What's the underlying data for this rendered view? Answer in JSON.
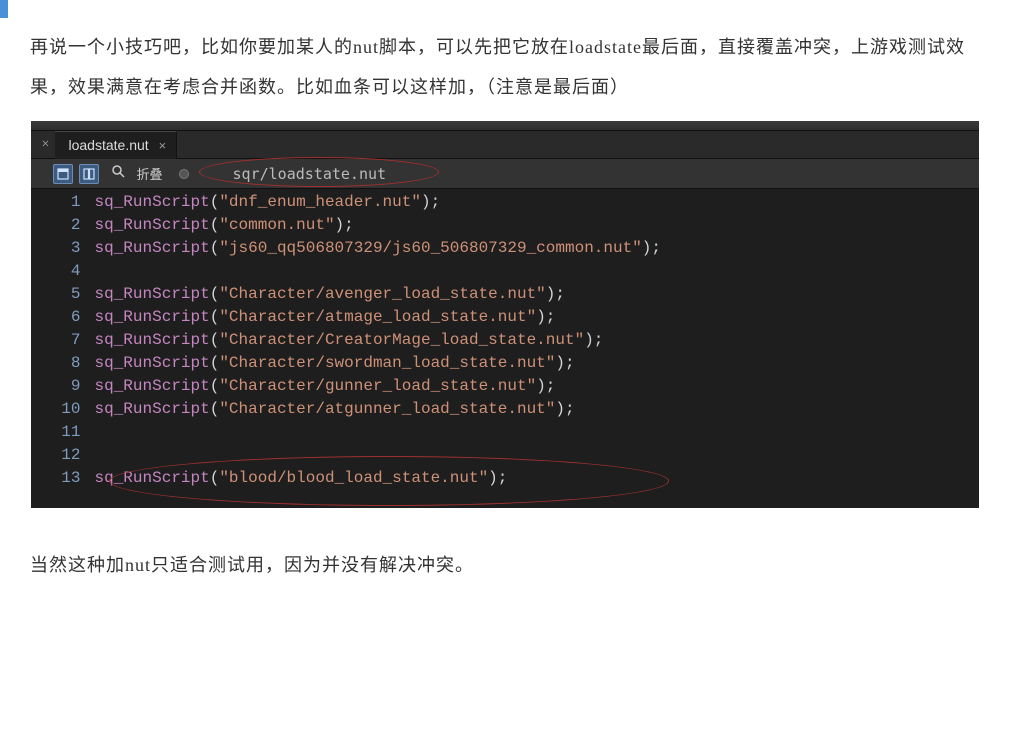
{
  "paragraph_top": "再说一个小技巧吧，比如你要加某人的nut脚本，可以先把它放在loadstate最后面，直接覆盖冲突，上游戏测试效果，效果满意在考虑合并函数。比如血条可以这样加，（注意是最后面）",
  "paragraph_bottom": "当然这种加nut只适合测试用，因为并没有解决冲突。",
  "editor": {
    "tab_name": "loadstate.nut",
    "fold_label": "折叠",
    "file_path": "sqr/loadstate.nut",
    "lines": [
      {
        "n": 1,
        "fn": "sq_RunScript",
        "arg": "\"dnf_enum_header.nut\""
      },
      {
        "n": 2,
        "fn": "sq_RunScript",
        "arg": "\"common.nut\""
      },
      {
        "n": 3,
        "fn": "sq_RunScript",
        "arg": "\"js60_qq506807329/js60_506807329_common.nut\""
      },
      {
        "n": 4,
        "blank": true
      },
      {
        "n": 5,
        "fn": "sq_RunScript",
        "arg": "\"Character/avenger_load_state.nut\""
      },
      {
        "n": 6,
        "fn": "sq_RunScript",
        "arg": "\"Character/atmage_load_state.nut\""
      },
      {
        "n": 7,
        "fn": "sq_RunScript",
        "arg": "\"Character/CreatorMage_load_state.nut\""
      },
      {
        "n": 8,
        "fn": "sq_RunScript",
        "arg": "\"Character/swordman_load_state.nut\""
      },
      {
        "n": 9,
        "fn": "sq_RunScript",
        "arg": "\"Character/gunner_load_state.nut\""
      },
      {
        "n": 10,
        "fn": "sq_RunScript",
        "arg": "\"Character/atgunner_load_state.nut\""
      },
      {
        "n": 11,
        "blank": true
      },
      {
        "n": 12,
        "blank": true
      },
      {
        "n": 13,
        "fn": "sq_RunScript",
        "arg": "\"blood/blood_load_state.nut\""
      }
    ]
  }
}
